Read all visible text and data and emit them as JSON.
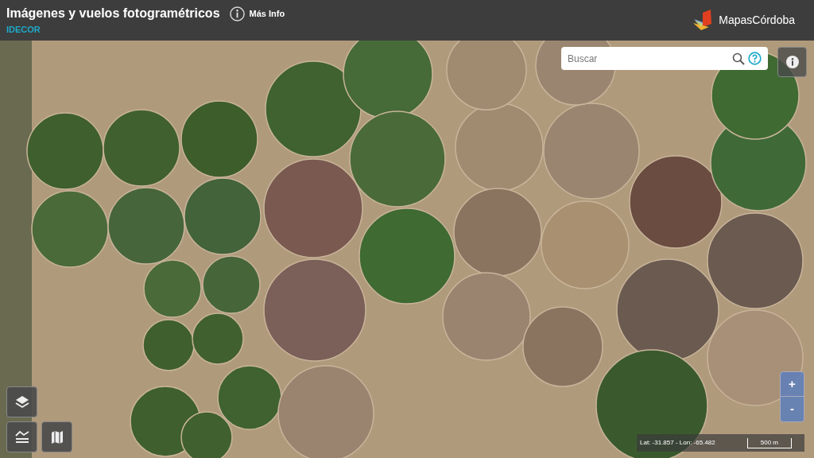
{
  "header": {
    "title": "Imágenes y vuelos fotogramétricos",
    "more_info": "Más Info",
    "subtitle": "IDECOR",
    "logo_text": "MapasCórdoba"
  },
  "search": {
    "placeholder": "Buscar"
  },
  "zoom": {
    "in": "+",
    "out": "-"
  },
  "status": {
    "coords": "Lat: -31.857 - Lon: -65.482",
    "scale": "500 m"
  }
}
